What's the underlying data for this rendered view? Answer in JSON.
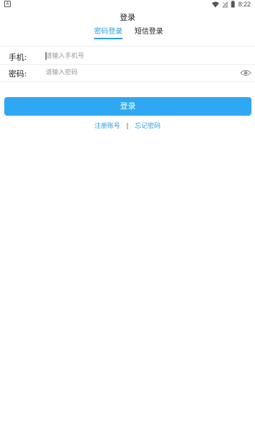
{
  "status_bar": {
    "left_icon": "A",
    "time": "8:22",
    "icons": [
      "wifi-icon",
      "sim-icon",
      "battery-icon"
    ]
  },
  "header": {
    "title": "登录"
  },
  "tabs": {
    "password_login": "密码登录",
    "sms_login": "短信登录",
    "active": "password_login"
  },
  "form": {
    "phone_label": "手机:",
    "phone_placeholder": "请输入手机号",
    "password_label": "密码:",
    "password_placeholder": "请输入密码"
  },
  "actions": {
    "login_button": "登录",
    "register_link": "注册账号",
    "separator": "|",
    "forgot_link": "忘记密码"
  },
  "colors": {
    "accent": "#2d9ee0",
    "button": "#2ea8f2"
  }
}
